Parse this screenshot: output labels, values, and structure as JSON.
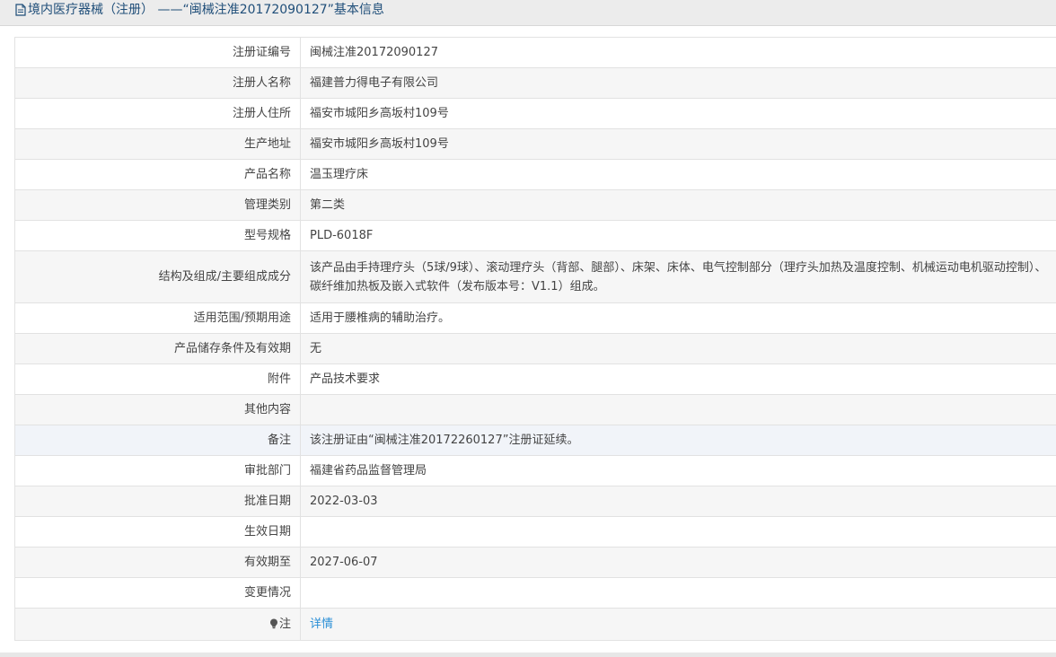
{
  "header": {
    "title": "境内医疗器械（注册） ——“闽械注准20172090127”基本信息"
  },
  "rows": [
    {
      "label": "注册证编号",
      "value": "闽械注准20172090127"
    },
    {
      "label": "注册人名称",
      "value": "福建普力得电子有限公司"
    },
    {
      "label": "注册人住所",
      "value": "福安市城阳乡高坂村109号"
    },
    {
      "label": "生产地址",
      "value": "福安市城阳乡高坂村109号"
    },
    {
      "label": "产品名称",
      "value": "温玉理疗床"
    },
    {
      "label": "管理类别",
      "value": "第二类"
    },
    {
      "label": "型号规格",
      "value": "PLD-6018F"
    },
    {
      "label": "结构及组成/主要组成成分",
      "value": "该产品由手持理疗头（5球/9球）、滚动理疗头（背部、腿部）、床架、床体、电气控制部分（理疗头加热及温度控制、机械运动电机驱动控制）、碳纤维加热板及嵌入式软件（发布版本号：V1.1）组成。"
    },
    {
      "label": "适用范围/预期用途",
      "value": "适用于腰椎病的辅助治疗。"
    },
    {
      "label": "产品储存条件及有效期",
      "value": "无"
    },
    {
      "label": "附件",
      "value": "产品技术要求"
    },
    {
      "label": "其他内容",
      "value": ""
    },
    {
      "label": "备注",
      "value": "该注册证由“闽械注准20172260127”注册证延续。"
    },
    {
      "label": "审批部门",
      "value": "福建省药品监督管理局"
    },
    {
      "label": "批准日期",
      "value": "2022-03-03"
    },
    {
      "label": "生效日期",
      "value": ""
    },
    {
      "label": "有效期至",
      "value": "2027-06-07"
    },
    {
      "label": "变更情况",
      "value": ""
    }
  ],
  "note": {
    "label": "注",
    "link_text": "详情",
    "icon": "lightbulb-icon"
  },
  "colors": {
    "header_text": "#1f4e79",
    "link": "#2a8fd6",
    "highlight_row": "#f1f4f9"
  }
}
